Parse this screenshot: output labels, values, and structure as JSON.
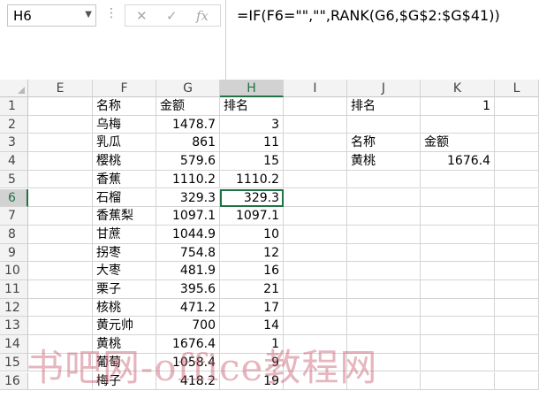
{
  "name_box": {
    "value": "H6"
  },
  "formula_buttons": {
    "cancel": "✕",
    "enter": "✓",
    "fx": "fx"
  },
  "formula": "=IF(F6=\"\",\"\",RANK(G6,$G$2:$G$41))",
  "columns": [
    "E",
    "F",
    "G",
    "H",
    "I",
    "J",
    "K",
    "L"
  ],
  "rows": [
    "1",
    "2",
    "3",
    "4",
    "5",
    "6",
    "7",
    "8",
    "9",
    "10",
    "11",
    "12",
    "13",
    "14",
    "15",
    "16"
  ],
  "table": {
    "headers": {
      "name": "名称",
      "amount": "金额",
      "rank": "排名"
    },
    "records": [
      {
        "name": "乌梅",
        "amount": "1478.7",
        "rank": "3"
      },
      {
        "name": "乳瓜",
        "amount": "861",
        "rank": "11"
      },
      {
        "name": "樱桃",
        "amount": "579.6",
        "rank": "15"
      },
      {
        "name": "香蕉",
        "amount": "1110.2",
        "rank": "1110.2"
      },
      {
        "name": "石榴",
        "amount": "329.3",
        "rank": "329.3"
      },
      {
        "name": "香蕉梨",
        "amount": "1097.1",
        "rank": "1097.1"
      },
      {
        "name": "甘蔗",
        "amount": "1044.9",
        "rank": "10"
      },
      {
        "name": "拐枣",
        "amount": "754.8",
        "rank": "12"
      },
      {
        "name": "大枣",
        "amount": "481.9",
        "rank": "16"
      },
      {
        "name": "栗子",
        "amount": "395.6",
        "rank": "21"
      },
      {
        "name": "核桃",
        "amount": "471.2",
        "rank": "17"
      },
      {
        "name": "黄元帅",
        "amount": "700",
        "rank": "14"
      },
      {
        "name": "黄桃",
        "amount": "1676.4",
        "rank": "1"
      },
      {
        "name": "葡萄",
        "amount": "1058.4",
        "rank": "9"
      },
      {
        "name": "梅子",
        "amount": "418.2",
        "rank": "19"
      }
    ]
  },
  "lookup": {
    "rank_label": "排名",
    "rank_value": "1",
    "name_header": "名称",
    "amount_header": "金额",
    "name_value": "黄桃",
    "amount_value": "1676.4"
  },
  "watermark": "书吧网-office教程网",
  "colors": {
    "accent": "#217346",
    "watermark": "#c85a6e"
  }
}
